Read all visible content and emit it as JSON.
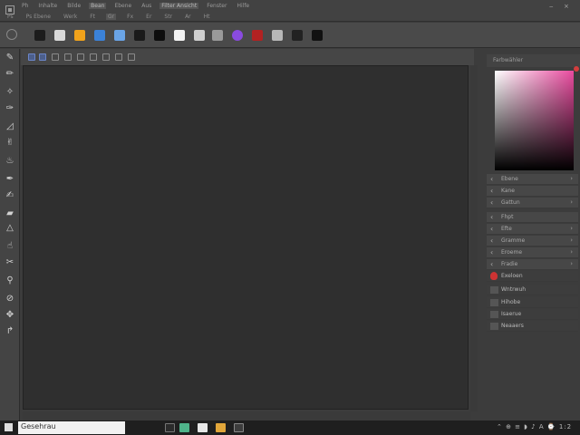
{
  "menubar": {
    "menu_items": [
      "Ph",
      "Inhalte",
      "Bilde",
      "Bean",
      "Ebene",
      "Aus",
      "Filter Ansicht",
      "Fenster",
      "Hilfe"
    ],
    "sub_items": [
      "Ps",
      "Ps Ebene",
      "Werk",
      "Ft",
      "Gr",
      "Fx",
      "Er",
      "Str",
      "Ar",
      "Ht"
    ],
    "close_label": "×"
  },
  "options": {
    "swatches": [
      "#1c1c1c",
      "#d8d8d8",
      "#f0a21b",
      "#3b82d9",
      "#6aa4e6",
      "#1a1a1a",
      "#0d0d0d",
      "#f3f3f3",
      "#cfcfcf",
      "#9a9a9a",
      "#8a4be0",
      "#b22222",
      "#b8b8b8",
      "#222222",
      "#111111"
    ]
  },
  "tools": [
    {
      "icon": "brush-icon",
      "glyph": "✎"
    },
    {
      "icon": "pencil-icon",
      "glyph": "✏"
    },
    {
      "icon": "healing-brush-icon",
      "glyph": "✧"
    },
    {
      "icon": "clone-stamp-icon",
      "glyph": "✑"
    },
    {
      "icon": "eraser-icon",
      "glyph": "◿"
    },
    {
      "icon": "smudge-icon",
      "glyph": "✌"
    },
    {
      "icon": "blur-icon",
      "glyph": "♨"
    },
    {
      "icon": "dodge-icon",
      "glyph": "✒"
    },
    {
      "icon": "pen-icon",
      "glyph": "✍"
    },
    {
      "icon": "fill-icon",
      "glyph": "▰"
    },
    {
      "icon": "triangle-shape-icon",
      "glyph": "△"
    },
    {
      "icon": "hand-icon",
      "glyph": "☝"
    },
    {
      "icon": "lasso-icon",
      "glyph": "✂"
    },
    {
      "icon": "eyedropper-icon",
      "glyph": "⚲"
    },
    {
      "icon": "ruler-icon",
      "glyph": "⊘"
    },
    {
      "icon": "move-icon",
      "glyph": "✥"
    },
    {
      "icon": "path-select-icon",
      "glyph": "↱"
    }
  ],
  "color_panel": {
    "title": "Farbwähler",
    "gradient_left": "#ffffff",
    "gradient_right": "#e94b9f"
  },
  "layers": [
    {
      "label": "Ebene",
      "chevron": "›",
      "icon": "‹",
      "style": "normal"
    },
    {
      "label": "Kane",
      "chevron": "",
      "icon": "‹",
      "style": "normal"
    },
    {
      "label": "Gattun",
      "chevron": "›",
      "icon": "‹",
      "style": "normal"
    },
    {
      "label": "Fhpt",
      "chevron": "",
      "icon": "‹",
      "style": "normal"
    },
    {
      "label": "Efte",
      "chevron": "›",
      "icon": "‹",
      "style": "normal"
    },
    {
      "label": "Gramme",
      "chevron": "›",
      "icon": "‹",
      "style": "normal"
    },
    {
      "label": "Eroeme",
      "chevron": "›",
      "icon": "‹",
      "style": "normal"
    },
    {
      "label": "Fradie",
      "chevron": "›",
      "icon": "‹",
      "style": "normal"
    },
    {
      "label": "Exeloen",
      "chevron": "",
      "icon": "red",
      "style": "dark"
    },
    {
      "label": "Wntrwuh",
      "chevron": "",
      "icon": "thumb",
      "style": "dark"
    },
    {
      "label": "Hihobe",
      "chevron": "",
      "icon": "thumb",
      "style": "dark"
    },
    {
      "label": "Isaerue",
      "chevron": "",
      "icon": "thumb",
      "style": "dark"
    },
    {
      "label": "Neaaers",
      "chevron": "",
      "icon": "thumb",
      "style": "dark"
    }
  ],
  "status": {
    "field_text": "Gesehrau",
    "tray": "⌃ ⊕ ≡ ◗ ♪ A ⌚ 1:2"
  }
}
